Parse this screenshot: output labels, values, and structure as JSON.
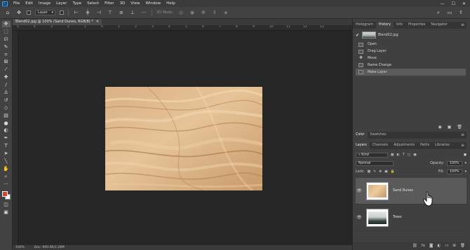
{
  "app": {
    "menus": [
      "File",
      "Edit",
      "Image",
      "Layer",
      "Type",
      "Select",
      "Filter",
      "3D",
      "View",
      "Window",
      "Help"
    ],
    "window_controls": [
      "—",
      "☐",
      "✕"
    ],
    "logo_text": "Ps"
  },
  "options_bar": {
    "auto_select_value": "Layer",
    "mode_label": "3D Mode:"
  },
  "document": {
    "tab_title": "Blend02.jpg @ 100% (Sand Dunes, RGB/8) *",
    "tab_close": "✕"
  },
  "ruler": {
    "top_ticks": [
      "5",
      "4",
      "3",
      "2",
      "1",
      "0",
      "1",
      "2",
      "3",
      "4",
      "5",
      "6",
      "7",
      "8",
      "9",
      "10",
      "11",
      "12",
      "13"
    ]
  },
  "status_bar": {
    "zoom": "100%",
    "doc_size": "Doc: 900.0K/2.28M"
  },
  "colors": {
    "foreground": "#e23b2e",
    "background": "#ffffff",
    "sand_light": "#e2bc8e",
    "sand_dark": "#b8875a",
    "canvas_bg": "#262626"
  },
  "history_panel": {
    "tabs": [
      "Histogram",
      "History",
      "Info",
      "Properties",
      "Navigator"
    ],
    "active_tab": "History",
    "snapshot_label": "Blend02.jpg",
    "items": [
      "Open",
      "Drag Layer",
      "Move",
      "Name Change",
      "Make Layer"
    ],
    "selected_item": "Make Layer"
  },
  "color_panel": {
    "tabs": [
      "Color",
      "Swatches"
    ]
  },
  "layers_panel": {
    "tabs": [
      "Layers",
      "Channels",
      "Adjustments",
      "Paths",
      "Libraries"
    ],
    "filter_label": "Kind",
    "blend_mode": "Normal",
    "opacity_label": "Opacity:",
    "opacity_value": "100%",
    "lock_label": "Lock:",
    "fill_label": "Fill:",
    "fill_value": "100%",
    "layers": [
      {
        "name": "Sand Dunes",
        "visible": true,
        "selected": true
      },
      {
        "name": "Trees",
        "visible": true,
        "selected": false
      }
    ]
  }
}
